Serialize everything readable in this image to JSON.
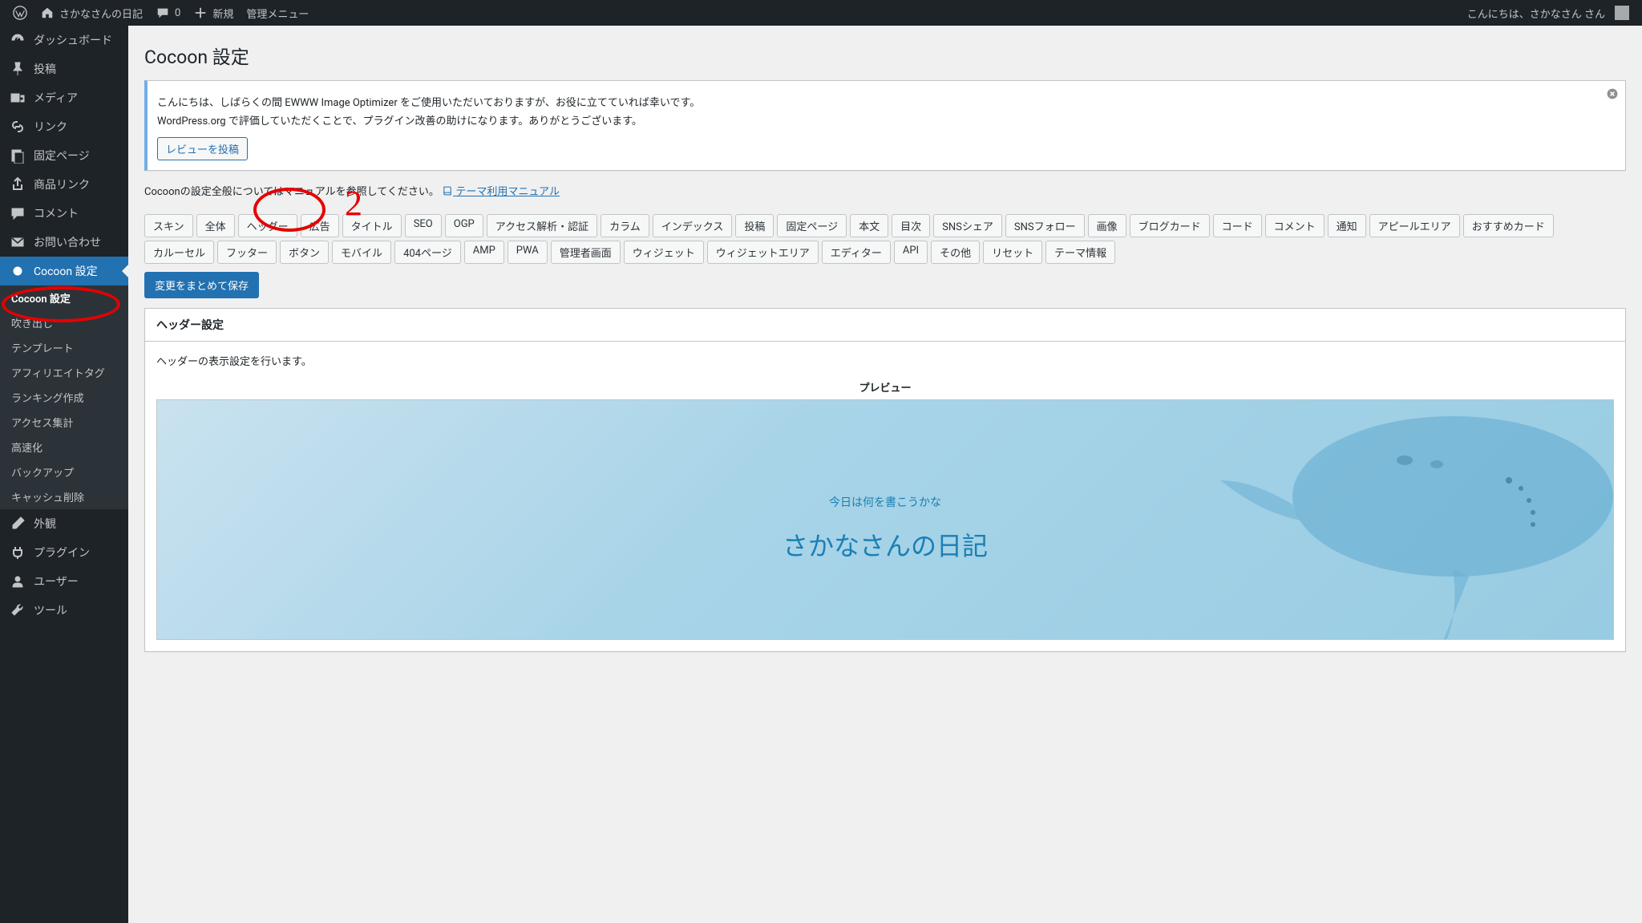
{
  "adminbar": {
    "site_name": "さかなさんの日記",
    "comments": "0",
    "new_label": "新規",
    "admin_menu": "管理メニュー",
    "greeting": "こんにちは、さかなさん さん"
  },
  "sidebar": {
    "items": [
      {
        "label": "ダッシュボード",
        "icon": "dashboard"
      },
      {
        "label": "投稿",
        "icon": "pin"
      },
      {
        "label": "メディア",
        "icon": "media"
      },
      {
        "label": "リンク",
        "icon": "link"
      },
      {
        "label": "固定ページ",
        "icon": "page"
      },
      {
        "label": "商品リンク",
        "icon": "share"
      },
      {
        "label": "コメント",
        "icon": "comment"
      },
      {
        "label": "お問い合わせ",
        "icon": "mail"
      },
      {
        "label": "Cocoon 設定",
        "icon": "dot",
        "active": true
      },
      {
        "label": "外観",
        "icon": "brush"
      },
      {
        "label": "プラグイン",
        "icon": "plug"
      },
      {
        "label": "ユーザー",
        "icon": "user"
      },
      {
        "label": "ツール",
        "icon": "tool"
      }
    ],
    "submenu": [
      "Cocoon 設定",
      "吹き出し",
      "テンプレート",
      "アフィリエイトタグ",
      "ランキング作成",
      "アクセス集計",
      "高速化",
      "バックアップ",
      "キャッシュ削除"
    ]
  },
  "page": {
    "title": "Cocoon 設定"
  },
  "notice": {
    "line1": "こんにちは、しばらくの間 EWWW Image Optimizer をご使用いただいておりますが、お役に立てていれば幸いです。",
    "line2": "WordPress.org で評価していただくことで、プラグイン改善の助けになります。ありがとうございます。",
    "review_btn": "レビューを投稿"
  },
  "manual": {
    "text": "Cocoonの設定全般についてはマニュアルを参照してください。",
    "link": "テーマ利用マニュアル"
  },
  "tabs": [
    "スキン",
    "全体",
    "ヘッダー",
    "広告",
    "タイトル",
    "SEO",
    "OGP",
    "アクセス解析・認証",
    "カラム",
    "インデックス",
    "投稿",
    "固定ページ",
    "本文",
    "目次",
    "SNSシェア",
    "SNSフォロー",
    "画像",
    "ブログカード",
    "コード",
    "コメント",
    "通知",
    "アピールエリア",
    "おすすめカード",
    "カルーセル",
    "フッター",
    "ボタン",
    "モバイル",
    "404ページ",
    "AMP",
    "PWA",
    "管理者画面",
    "ウィジェット",
    "ウィジェットエリア",
    "エディター",
    "API",
    "その他",
    "リセット",
    "テーマ情報"
  ],
  "save_button": "変更をまとめて保存",
  "section": {
    "header": "ヘッダー設定",
    "desc": "ヘッダーの表示設定を行います。",
    "preview_label": "プレビュー",
    "preview_sub": "今日は何を書こうかな",
    "preview_main": "さかなさんの日記"
  },
  "annotation": {
    "num": "2"
  }
}
